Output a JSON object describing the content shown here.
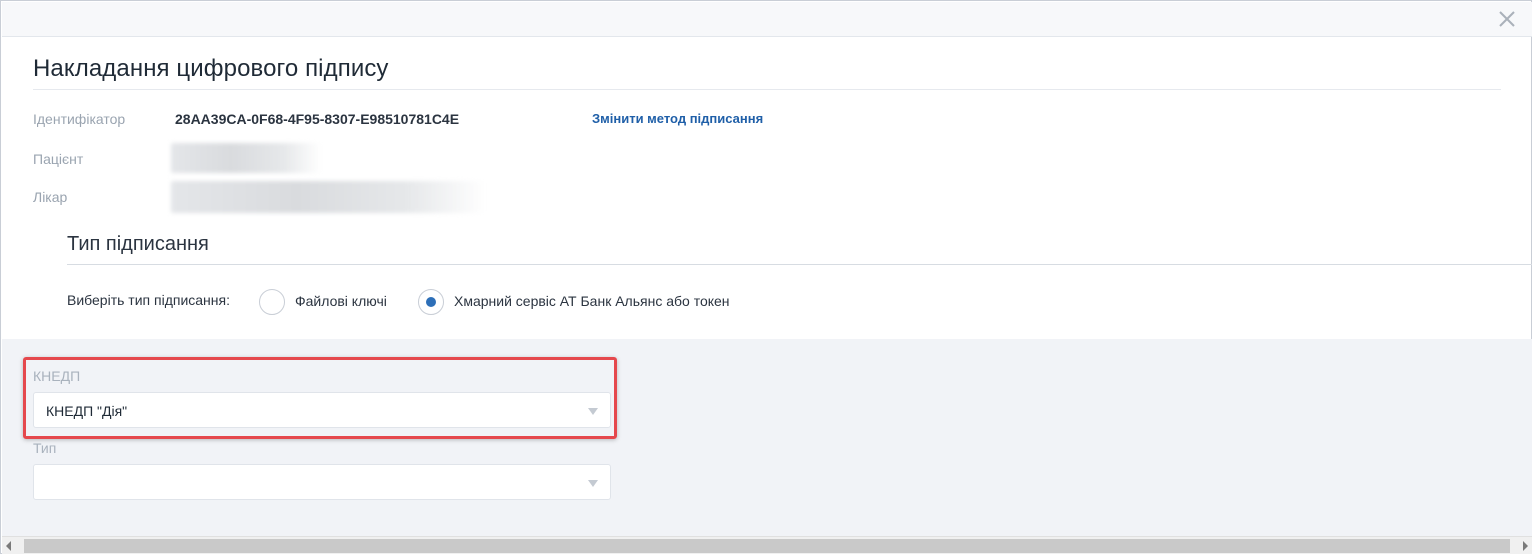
{
  "dialog": {
    "title": "Накладання цифрового підпису",
    "close_icon": "close-icon"
  },
  "info": {
    "identifier_label": "Ідентифікатор",
    "identifier_value": "28AA39CA-0F68-4F95-8307-E98510781C4E",
    "change_method_link": "Змінити метод підписання",
    "patient_label": "Пацієнт",
    "doctor_label": "Лікар"
  },
  "signing_type": {
    "section_title": "Тип підписання",
    "choose_label": "Виберіть тип підписання:",
    "options": [
      {
        "label": "Файлові ключі",
        "selected": false
      },
      {
        "label": "Хмарний сервіс АТ Банк Альянс або токен",
        "selected": true
      }
    ]
  },
  "form": {
    "kednp": {
      "label": "КНЕДП",
      "value": "КНЕДП \"Дія\""
    },
    "type": {
      "label": "Тип",
      "value": ""
    }
  },
  "colors": {
    "accent": "#2d6fb8",
    "link": "#1f5fa8",
    "highlight": "#e5484d"
  }
}
